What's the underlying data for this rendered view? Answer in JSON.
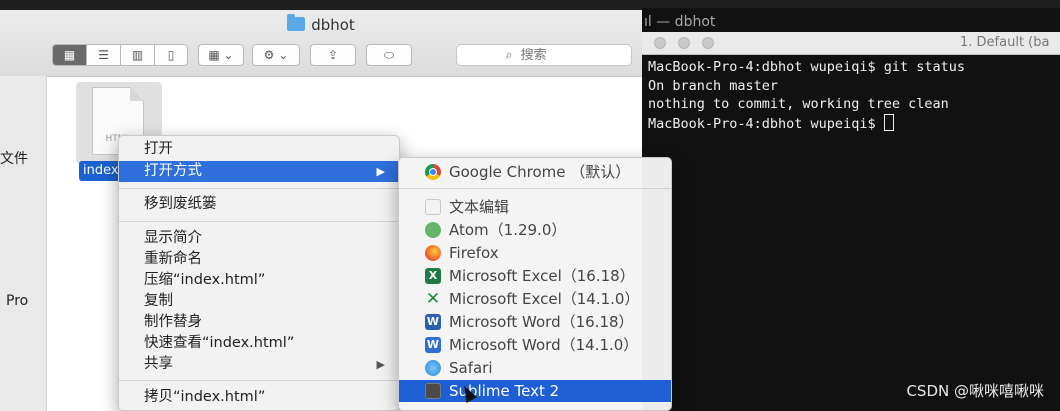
{
  "finder": {
    "window_title": "dbhot",
    "search_placeholder": "搜索",
    "sidebar": [
      {
        "label": "文件"
      },
      {
        "label": "Pro"
      }
    ],
    "file": {
      "name": "index.html",
      "type_label": "HTML"
    }
  },
  "terminal": {
    "ghost_title": "ıl — dbhot",
    "tab_title": "1. Default (ba",
    "lines": [
      "MacBook-Pro-4:dbhot wupeiqi$ git status",
      "On branch master",
      "nothing to commit, working tree clean"
    ],
    "prompt": "MacBook-Pro-4:dbhot wupeiqi$ "
  },
  "context_menu": {
    "items": [
      {
        "label": "打开"
      },
      {
        "label": "打开方式"
      },
      {
        "label": "移到废纸篓"
      },
      {
        "label": "显示简介"
      },
      {
        "label": "重新命名"
      },
      {
        "label": "压缩“index.html”"
      },
      {
        "label": "复制"
      },
      {
        "label": "制作替身"
      },
      {
        "label": "快速查看“index.html”"
      },
      {
        "label": "共享"
      },
      {
        "label": "拷贝“index.html”"
      }
    ],
    "arrow": "▶"
  },
  "open_with": {
    "apps": [
      {
        "label": "Google Chrome （默认）",
        "icon": "chrome-icon"
      },
      {
        "label": "文本编辑",
        "icon": "textedit-icon"
      },
      {
        "label": "Atom（1.29.0）",
        "icon": "atom-icon"
      },
      {
        "label": "Firefox",
        "icon": "firefox-icon"
      },
      {
        "label": "Microsoft Excel（16.18）",
        "icon": "excel-icon"
      },
      {
        "label": "Microsoft Excel（14.1.0）",
        "icon": "excel-icon"
      },
      {
        "label": "Microsoft Word（16.18）",
        "icon": "word-icon"
      },
      {
        "label": "Microsoft Word（14.1.0）",
        "icon": "word-icon"
      },
      {
        "label": "Safari",
        "icon": "safari-icon"
      },
      {
        "label": "Sublime Text 2",
        "icon": "sublime-icon"
      }
    ]
  },
  "watermark": "CSDN @啾咪嘻啾咪",
  "colors": {
    "highlight": "#2f6fdc",
    "file_selected": "#1b61d1"
  }
}
